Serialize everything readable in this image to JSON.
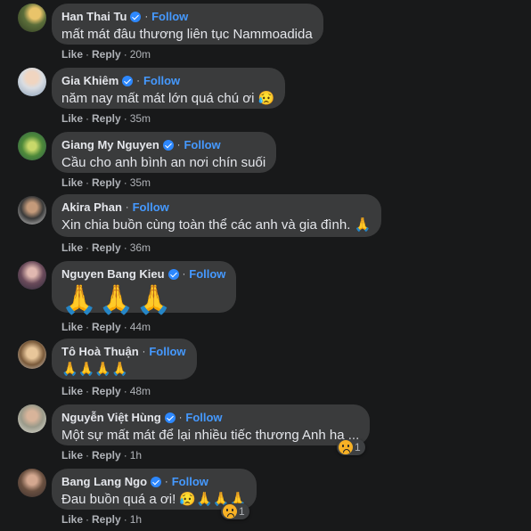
{
  "follow_label": "Follow",
  "like_label": "Like",
  "reply_label": "Reply",
  "colors": {
    "background": "#18191a",
    "bubble": "#3a3b3c",
    "follow": "#4599ff",
    "verified": "#2d88ff",
    "meta": "#b0b3b8"
  },
  "comments": [
    {
      "author": "Han Thai Tu",
      "text": "mất mát đâu thương liên tục Nammoadida",
      "time": "20m"
    },
    {
      "author": "Gia Khiêm",
      "text": "năm nay mất mát lớn quá chú ơi 😥",
      "time": "35m"
    },
    {
      "author": "Giang My Nguyen",
      "text": "Cầu cho anh bình an nơi chín suối",
      "time": "35m"
    },
    {
      "author": "Akira Phan",
      "text": "Xin chia buồn cùng toàn thể các anh và gia đình. 🙏",
      "time": "36m"
    },
    {
      "author": "Nguyen Bang Kieu",
      "text": "🙏🙏🙏",
      "time": "44m"
    },
    {
      "author": "Tô Hoà Thuận",
      "text": "🙏🙏🙏🙏",
      "time": "48m"
    },
    {
      "author": "Nguyễn Việt Hùng",
      "text": "Một sự mất mát để lại nhiều tiếc thương Anh ha ...",
      "time": "1h",
      "reaction_count": "1",
      "reaction_icon": "sad-reaction-icon"
    },
    {
      "author": "Bang Lang Ngo",
      "text": "Đau buồn quá a ơi! 😥🙏🙏🙏",
      "time": "1h",
      "reaction_count": "1",
      "reaction_icon": "sad-reaction-icon"
    }
  ]
}
